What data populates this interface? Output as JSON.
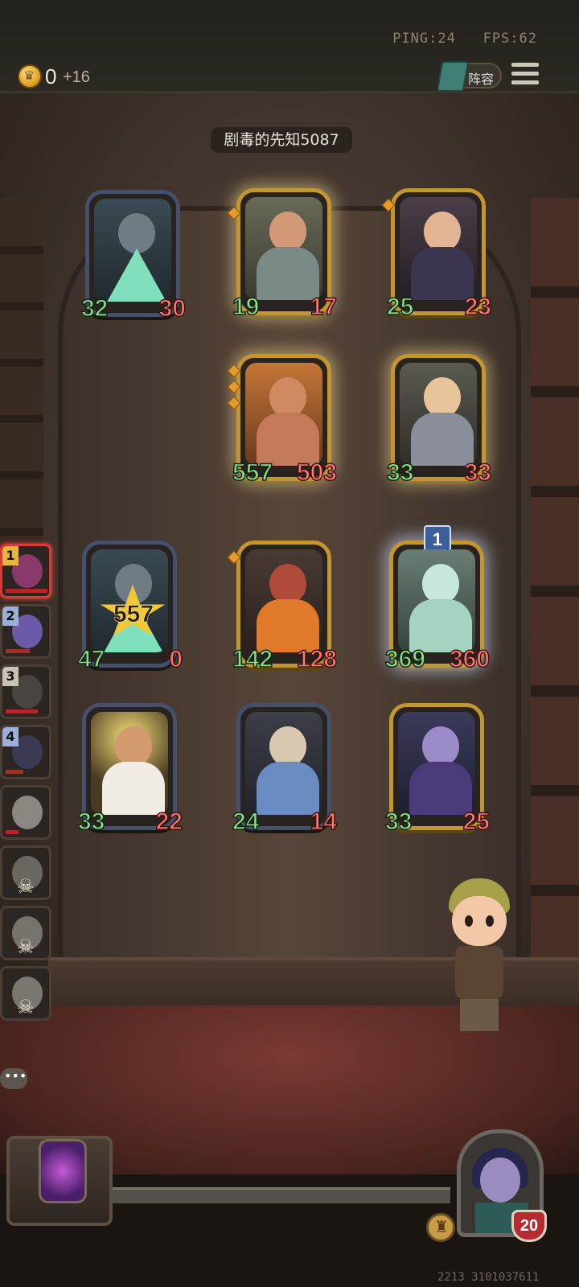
{
  "topbar": {
    "ping": "PING:24",
    "fps": "FPS:62",
    "gold": "0",
    "gold_income": "+16",
    "lineup_label": "阵容"
  },
  "enemy_name": "剧毒的先知5087",
  "enemy_board": [
    {
      "atk": "32",
      "hp": "30",
      "frame": "silver"
    },
    {
      "atk": "19",
      "hp": "17",
      "frame": "gold"
    },
    {
      "atk": "25",
      "hp": "23",
      "frame": "gold"
    },
    {
      "atk": "557",
      "hp": "503",
      "frame": "gold"
    },
    {
      "atk": "33",
      "hp": "33",
      "frame": "gold"
    }
  ],
  "player_board": [
    {
      "atk": "47",
      "hp": "0",
      "frame": "silver",
      "badge": "557"
    },
    {
      "atk": "142",
      "hp": "128",
      "frame": "gold"
    },
    {
      "atk": "369",
      "hp": "360",
      "frame": "gold",
      "tier": "1"
    },
    {
      "atk": "33",
      "hp": "22",
      "frame": "silver"
    },
    {
      "atk": "24",
      "hp": "14",
      "frame": "silver"
    },
    {
      "atk": "33",
      "hp": "25",
      "frame": "gold"
    }
  ],
  "roster": [
    {
      "rank": "1",
      "status": "alive"
    },
    {
      "rank": "2",
      "status": "alive"
    },
    {
      "rank": "3",
      "status": "alive"
    },
    {
      "rank": "4",
      "status": "alive"
    },
    {
      "rank": "",
      "status": "alive"
    },
    {
      "rank": "",
      "status": "dead"
    },
    {
      "rank": "",
      "status": "dead"
    },
    {
      "rank": "",
      "status": "dead"
    }
  ],
  "player": {
    "health": "20",
    "build_id": "2213 3101037611"
  },
  "colors": {
    "attack": "#8de08a",
    "health": "#ff7a70",
    "gold_frame": "#c4962f",
    "silver_frame": "#44506c",
    "active_slot": "#d63b35"
  },
  "icons": {
    "currency": "coin-icon",
    "lineup": "book-icon",
    "menu": "menu-icon",
    "chat": "chat-icon",
    "dead": "skull-icon",
    "tavern": "tavern-icon",
    "health": "shield-icon"
  }
}
